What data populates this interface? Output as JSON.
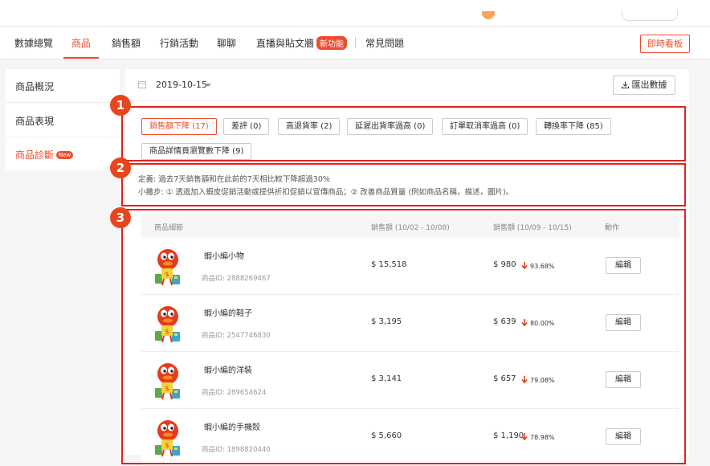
{
  "nav": {
    "items": [
      "數據總覽",
      "商品",
      "銷售額",
      "行銷活動",
      "聊聊",
      "直播與貼文牆",
      "常見問題"
    ],
    "new_badge": "新功能",
    "live_button": "即時看板"
  },
  "sidebar": {
    "items": [
      "商品概況",
      "商品表現",
      "商品診斷"
    ],
    "new_badge": "New"
  },
  "date": {
    "value": "2019-10-15"
  },
  "export_label": "匯出數據",
  "filters": [
    "銷售額下降 (17)",
    "差評 (0)",
    "高退貨率 (2)",
    "延遲出貨率過高 (0)",
    "訂單取消率過高 (0)",
    "轉換率下降 (85)",
    "商品詳情頁瀏覽數下降 (9)"
  ],
  "definition": {
    "line1": "定義: 過去7天銷售額和在此前的7天相比較下降超過30%",
    "line2": "小撇步: ① 透過加入蝦皮促銷活動或提供折扣促銷以宣傳商品；② 改善商品質量 (例如商品名稱，描述，圖片)。"
  },
  "table": {
    "headers": [
      "商品細節",
      "銷售額 (10/02 - 10/08)",
      "銷售額 (10/09 - 10/15)",
      "動作"
    ],
    "rows": [
      {
        "name": "蝦小編小物",
        "id": "商品ID: 2888269467",
        "sales_prev": "$ 15,518",
        "sales_curr": "$ 980",
        "drop": "93.68%",
        "action": "編輯"
      },
      {
        "name": "蝦小編的鞋子",
        "id": "商品ID: 2547746830",
        "sales_prev": "$ 3,195",
        "sales_curr": "$ 639",
        "drop": "80.00%",
        "action": "編輯"
      },
      {
        "name": "蝦小編的洋裝",
        "id": "商品ID: 289654624",
        "sales_prev": "$ 3,141",
        "sales_curr": "$ 657",
        "drop": "79.08%",
        "action": "編輯"
      },
      {
        "name": "蝦小編的手機殼",
        "id": "商品ID: 1898820440",
        "sales_prev": "$ 5,660",
        "sales_curr": "$ 1,190",
        "drop": "78.98%",
        "action": "編輯"
      }
    ]
  },
  "annotations": [
    "1",
    "2",
    "3"
  ],
  "colors": {
    "accent": "#ee4d2d",
    "annotation": "#e3221b"
  }
}
